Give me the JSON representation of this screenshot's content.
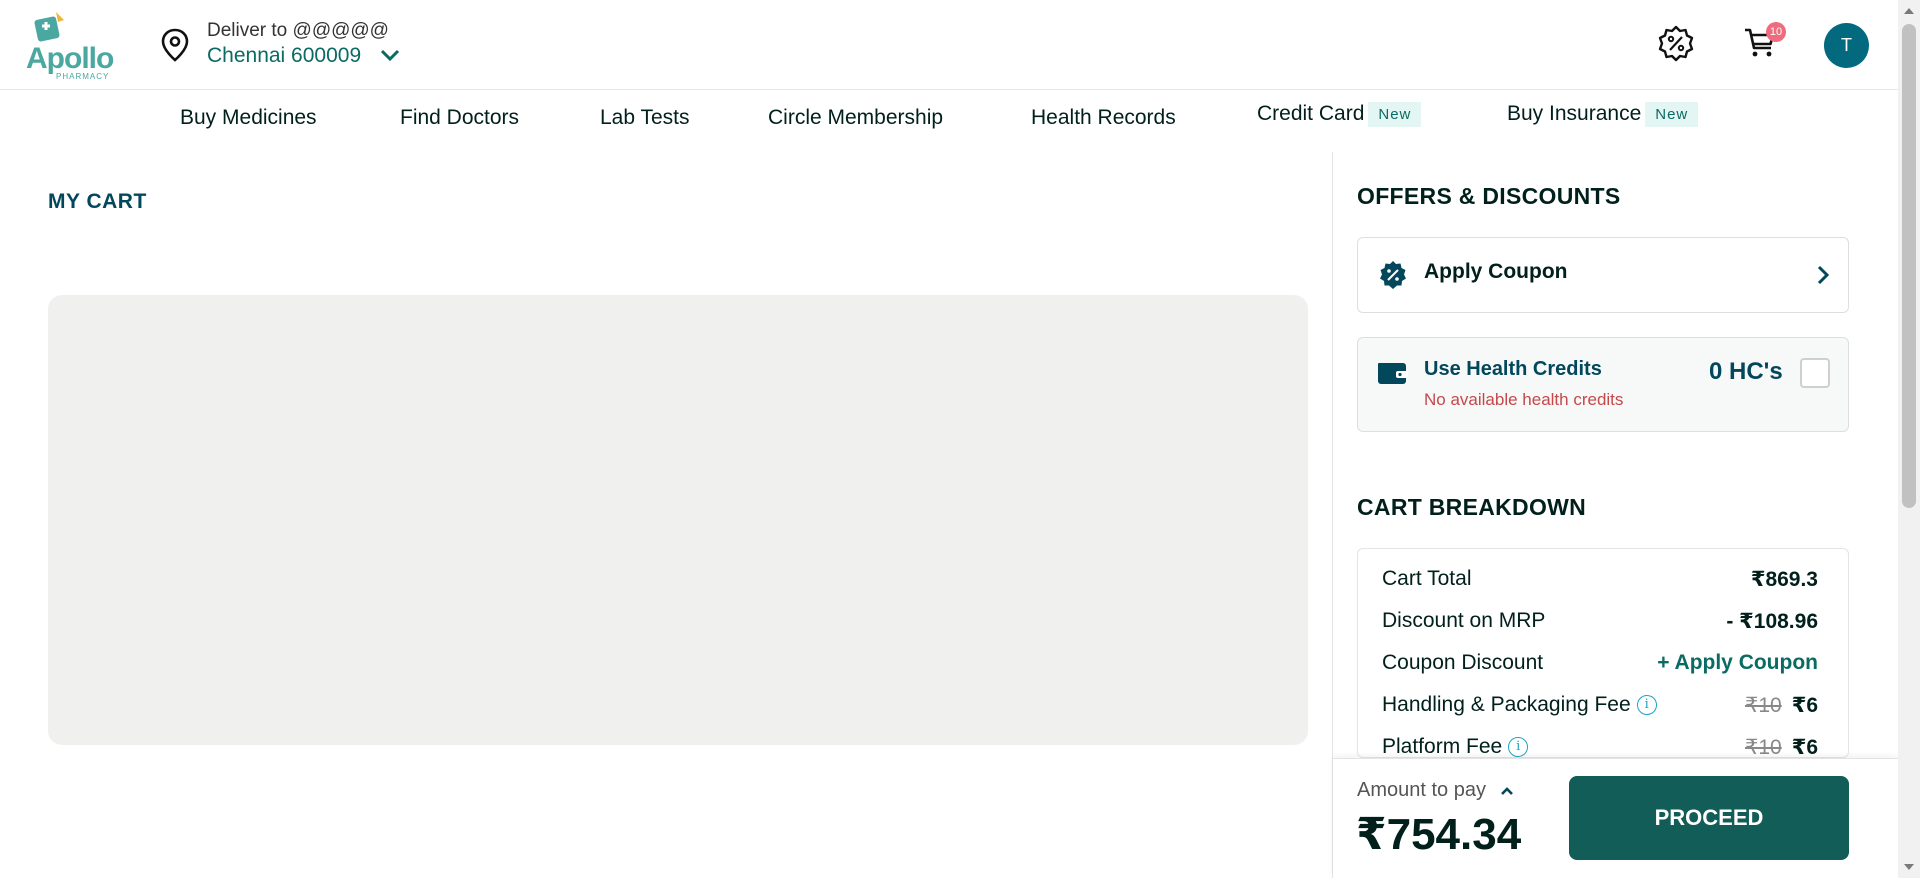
{
  "header": {
    "logo_text": "Apollo",
    "logo_sub": "PHARMACY",
    "deliver_label": "Deliver to @@@@@",
    "location": "Chennai 600009",
    "cart_count": "10",
    "avatar_initial": "T"
  },
  "nav": {
    "items": [
      {
        "label": "Buy Medicines"
      },
      {
        "label": "Find Doctors"
      },
      {
        "label": "Lab Tests"
      },
      {
        "label": "Circle Membership"
      },
      {
        "label": "Health Records"
      },
      {
        "label": "Credit Card",
        "badge": "New"
      },
      {
        "label": "Buy Insurance",
        "badge": "New"
      }
    ]
  },
  "main": {
    "title": "MY CART"
  },
  "offers": {
    "title": "OFFERS & DISCOUNTS",
    "apply_coupon": "Apply Coupon",
    "health_credits": {
      "label": "Use Health Credits",
      "sub": "No available health credits",
      "amount": "0 HC's"
    }
  },
  "breakdown": {
    "title": "CART BREAKDOWN",
    "rows": [
      {
        "label": "Cart Total",
        "value": "₹869.3"
      },
      {
        "label": "Discount on MRP",
        "value": "- ₹108.96"
      },
      {
        "label": "Coupon Discount",
        "value": "+ Apply Coupon"
      },
      {
        "label": "Handling & Packaging Fee",
        "old": "₹10",
        "value": "₹6"
      },
      {
        "label": "Platform Fee",
        "old": "₹10",
        "value": "₹6"
      }
    ]
  },
  "footer": {
    "amount_label": "Amount to pay",
    "amount": "₹754.34",
    "proceed": "PROCEED"
  },
  "colors": {
    "brand_teal": "#0a6b62",
    "primary_dark": "#02475b",
    "proceed_bg": "#125d57",
    "badge_pink": "#ef6b7e",
    "error_red": "#c5484a"
  }
}
